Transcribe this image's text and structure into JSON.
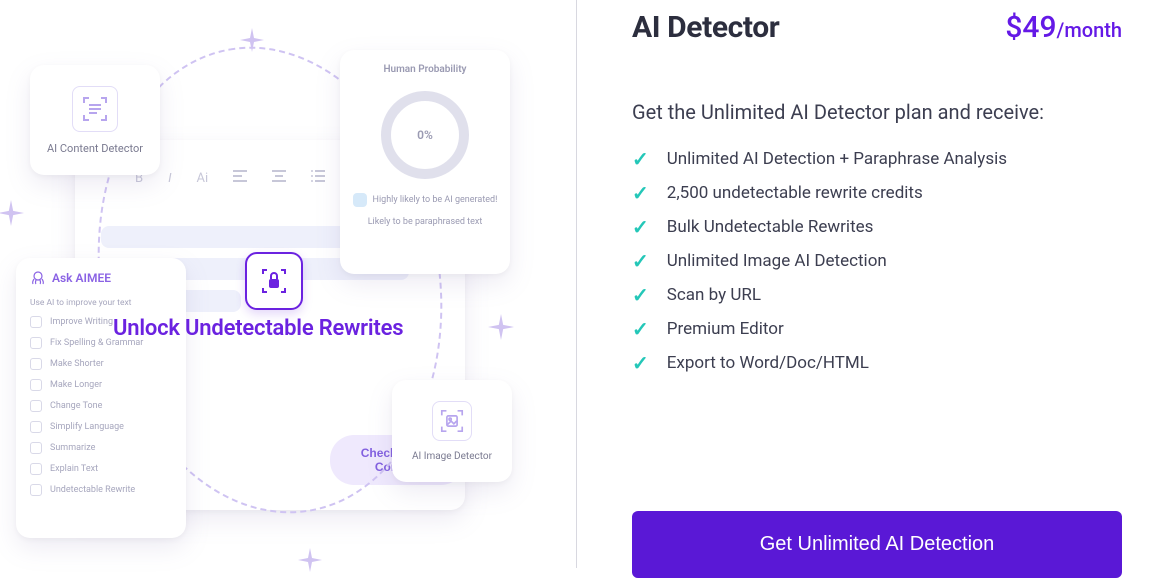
{
  "pricing": {
    "title": "AI Detector",
    "price": "$49",
    "period": "/month",
    "subtitle": "Get the Unlimited AI Detector plan and receive:",
    "features": [
      "Unlimited AI Detection + Paraphrase Analysis",
      "2,500 undetectable rewrite credits",
      "Bulk Undetectable Rewrites",
      "Unlimited Image AI Detection",
      "Scan by URL",
      "Premium Editor",
      "Export to Word/Doc/HTML"
    ],
    "cta_label": "Get Unlimited AI Detection"
  },
  "illustration": {
    "unlock_label": "Unlock Undetectable Rewrites",
    "content_detector": {
      "label": "AI Content Detector"
    },
    "image_detector": {
      "label": "AI Image Detector"
    },
    "editor": {
      "check_button": "Check For AI Content",
      "toolbar_items": [
        "B",
        "I",
        "Ai"
      ]
    },
    "probability": {
      "title": "Human Probability",
      "value": "0%",
      "line1": "Highly likely to be AI generated!",
      "line2": "Likely to be paraphrased text"
    },
    "aimee": {
      "title": "Ask AIMEE",
      "subtitle": "Use AI to improve your text",
      "items": [
        "Improve Writing",
        "Fix Spelling & Grammar",
        "Make Shorter",
        "Make Longer",
        "Change Tone",
        "Simplify Language",
        "Summarize",
        "Explain Text",
        "Undetectable Rewrite"
      ]
    }
  }
}
